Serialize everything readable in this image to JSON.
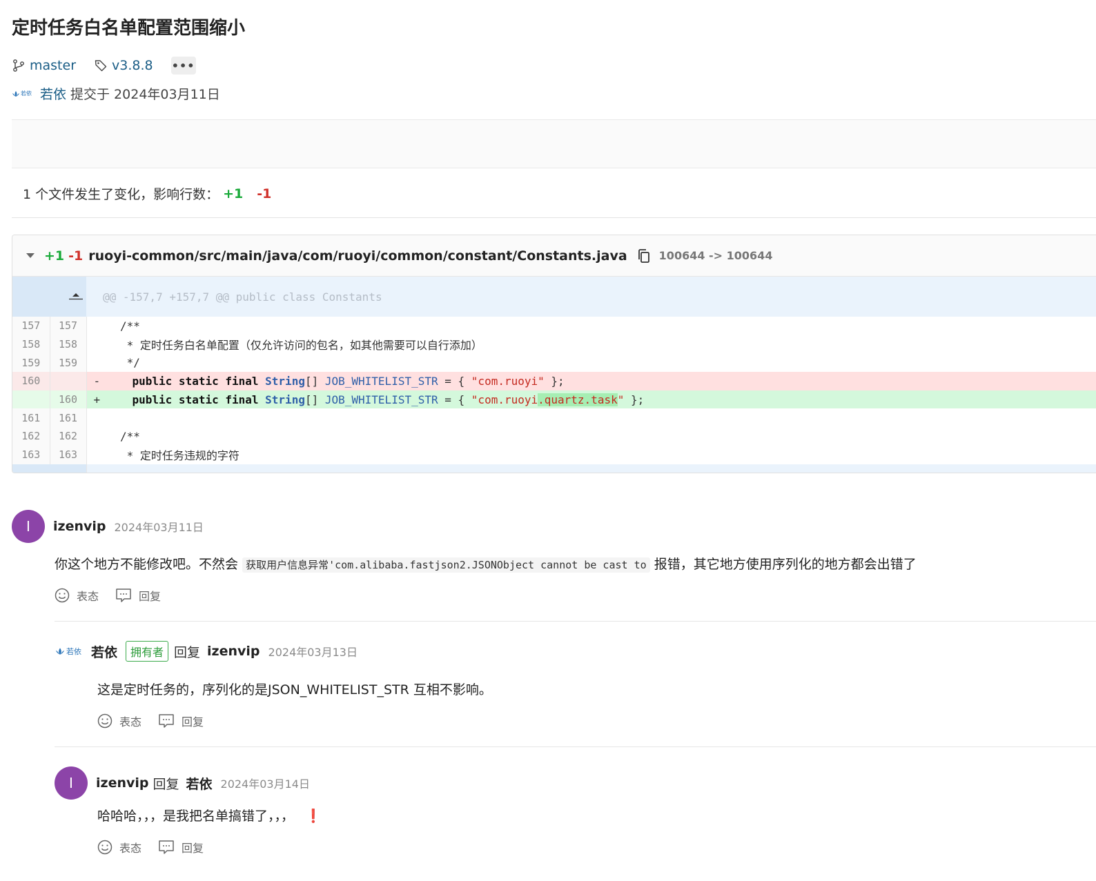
{
  "commit": {
    "title": "定时任务白名单配置范围缩小",
    "branch": "master",
    "tag": "v3.8.8",
    "more_label": "•••",
    "author_logo_text": "若依",
    "author": "若依",
    "committed_text": "提交于 2024年03月11日"
  },
  "stats": {
    "text": "1 个文件发生了变化，影响行数：",
    "additions": "+1",
    "deletions": "-1"
  },
  "diff_file": {
    "additions": "+1",
    "deletions": "-1",
    "path": "ruoyi-common/src/main/java/com/ruoyi/common/constant/Constants.java",
    "mode_change": "100644 -> 100644",
    "hunk_header": "@@ -157,7 +157,7 @@ public class Constants",
    "lines": [
      {
        "old": "157",
        "new": "157",
        "text": "    /**"
      },
      {
        "old": "158",
        "new": "158",
        "text": "     * 定时任务白名单配置（仅允许访问的包名，如其他需要可以自行添加）"
      },
      {
        "old": "159",
        "new": "159",
        "text": "     */"
      },
      {
        "old": "160",
        "new": "",
        "sign": "-",
        "kw": "public static final ",
        "type": "String",
        "rest": "[] ",
        "var": "JOB_WHITELIST_STR",
        "eq": " = { ",
        "str": "\"com.ruoyi\"",
        "end": " };"
      },
      {
        "old": "",
        "new": "160",
        "sign": "+",
        "kw": "public static final ",
        "type": "String",
        "rest": "[] ",
        "var": "JOB_WHITELIST_STR",
        "eq": " = { ",
        "str_a": "\"com.ruoyi",
        "str_hl": ".quartz.task",
        "str_b": "\"",
        "end": " };"
      },
      {
        "old": "161",
        "new": "161",
        "text": ""
      },
      {
        "old": "162",
        "new": "162",
        "text": "    /**"
      },
      {
        "old": "163",
        "new": "163",
        "text": "     * 定时任务违规的字符"
      }
    ]
  },
  "comments": [
    {
      "avatar_letter": "I",
      "user": "izenvip",
      "date": "2024年03月11日",
      "body_before": "你这个地方不能修改吧。不然会",
      "body_code": "获取用户信息异常'com.alibaba.fastjson2.JSONObject cannot be cast to",
      "body_after": "报错，其它地方使用序列化的地方都会出错了"
    },
    {
      "logo_text": "若依",
      "user": "若依",
      "badge": "拥有者",
      "reply_word": "回复",
      "reply_to": "izenvip",
      "date": "2024年03月13日",
      "body": "这是定时任务的，序列化的是JSON_WHITELIST_STR 互相不影响。"
    },
    {
      "avatar_letter": "I",
      "user": "izenvip",
      "reply_word": "回复",
      "reply_to": "若依",
      "date": "2024年03月14日",
      "body": "哈哈哈，，，是我把名单搞错了，，，",
      "emoji": "❗"
    }
  ],
  "actions": {
    "react": "表态",
    "reply": "回复"
  }
}
